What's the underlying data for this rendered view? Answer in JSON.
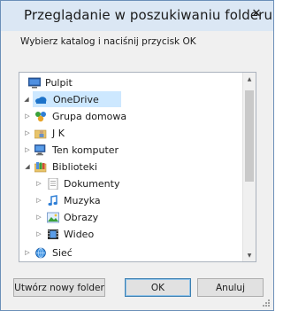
{
  "window": {
    "title": "Przeglądanie w poszukiwaniu folderu",
    "close_glyph": "✕"
  },
  "instruction": "Wybierz katalog i naciśnij przycisk OK",
  "tree": {
    "items": [
      {
        "label": "Pulpit",
        "icon": "desktop-icon",
        "expander": ""
      },
      {
        "label": "OneDrive",
        "icon": "cloud-icon",
        "expander": "expanded",
        "selected": true
      },
      {
        "label": "Grupa domowa",
        "icon": "homegroup-icon",
        "expander": "collapsed"
      },
      {
        "label": "J K",
        "icon": "user-folder-icon",
        "expander": "collapsed"
      },
      {
        "label": "Ten komputer",
        "icon": "computer-icon",
        "expander": "collapsed"
      },
      {
        "label": "Biblioteki",
        "icon": "libraries-icon",
        "expander": "expanded"
      },
      {
        "label": "Dokumenty",
        "icon": "documents-icon",
        "expander": "collapsed"
      },
      {
        "label": "Muzyka",
        "icon": "music-icon",
        "expander": "collapsed"
      },
      {
        "label": "Obrazy",
        "icon": "pictures-icon",
        "expander": "collapsed"
      },
      {
        "label": "Wideo",
        "icon": "video-icon",
        "expander": "collapsed"
      },
      {
        "label": "Sieć",
        "icon": "network-icon",
        "expander": "collapsed"
      }
    ]
  },
  "buttons": {
    "new_folder": "Utwórz nowy folder",
    "ok": "OK",
    "cancel": "Anuluj"
  },
  "colors": {
    "selection": "#cde8ff",
    "titlebar": "#dbe7f4",
    "accent": "#3c7fb1"
  }
}
